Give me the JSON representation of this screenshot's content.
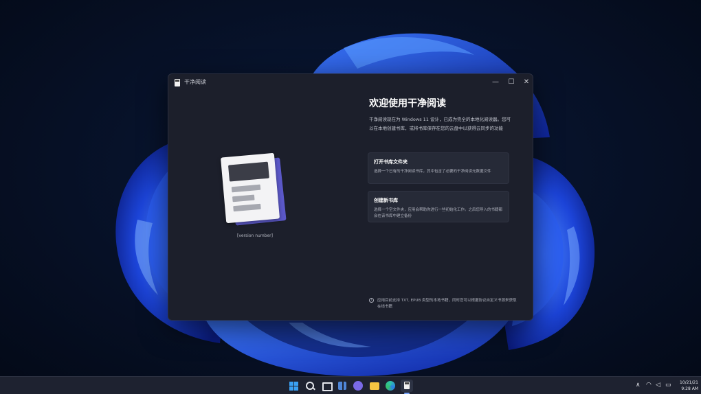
{
  "window": {
    "title": "干净阅读",
    "minimize": "—",
    "maximize": "☐",
    "close": "✕"
  },
  "illustration": {
    "version": "[version number]"
  },
  "welcome": {
    "title": "欢迎使用干净阅读",
    "description": "干净阅读现在为 Windows 11 设计，已成为完全的本地化阅读器。您可以在本地创建书库，或将书库保存在您的云盘中以获得云同步的功能"
  },
  "actions": [
    {
      "title": "打开书库文件夹",
      "description": "选择一个已有的干净阅读书库，其中包含了必要的干净阅读元数据文件"
    },
    {
      "title": "创建新书库",
      "description": "选择一个空文件夹，应用会帮助你进行一些初始化工作。之后您导入的书籍都会在该书库中建立备份"
    }
  ],
  "footer": {
    "info_icon": "i",
    "note": "应用目前支持 TXT, EPUB 类型的本地书籍，同时您可以根据协议自定义书源来获取在线书籍"
  },
  "taskbar": {
    "icons": [
      "start-icon",
      "search-icon",
      "task-view-icon",
      "widgets-icon",
      "chat-icon",
      "file-explorer-icon",
      "edge-icon",
      "clean-reader-icon"
    ],
    "tray": {
      "chevron": "∧",
      "wifi": "◠",
      "volume": "◁",
      "battery": "▭"
    },
    "date": "10/21/21",
    "time": "9:28 AM"
  },
  "colors": {
    "window_bg": "#1c1f2b",
    "card_bg": "#262a37",
    "accent_purple": "#5b58c8",
    "wallpaper_blue": "#1e4fe0"
  }
}
